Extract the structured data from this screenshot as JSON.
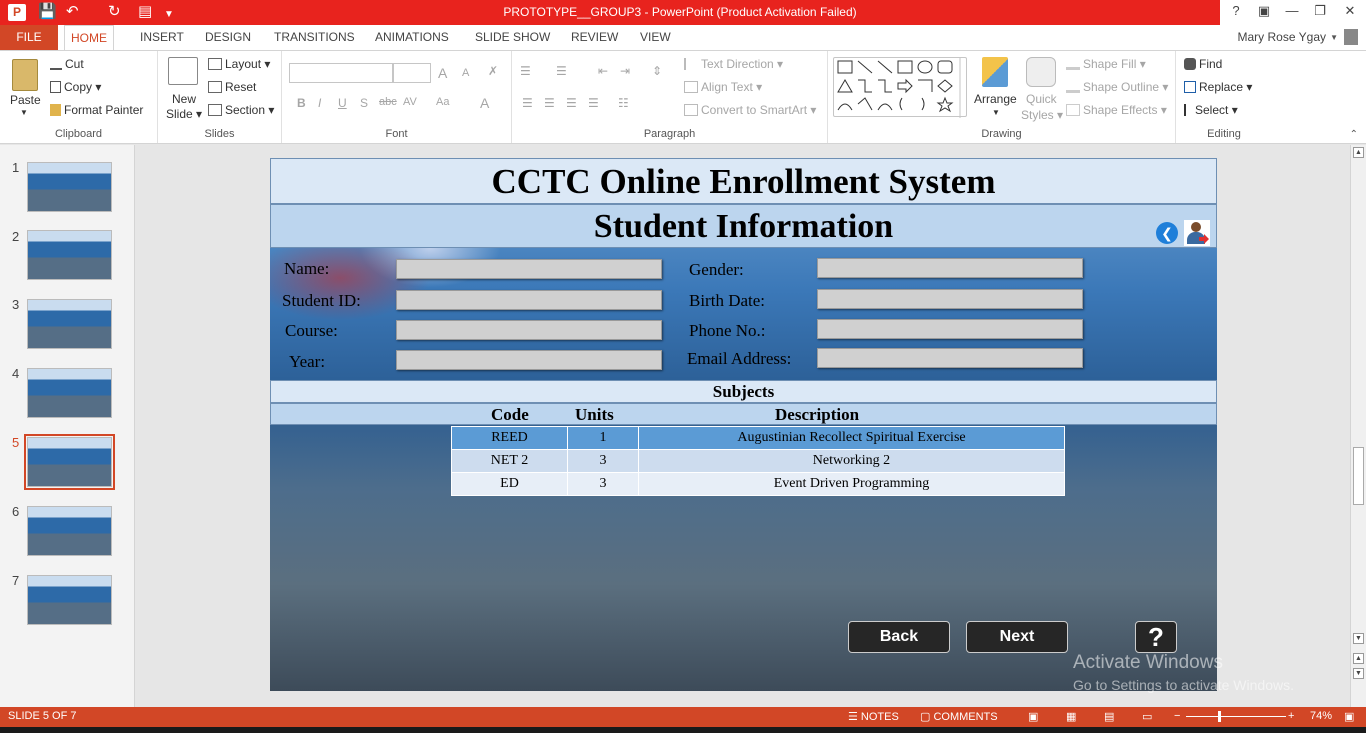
{
  "window": {
    "title": "PROTOTYPE__GROUP3 -  PowerPoint (Product Activation Failed)",
    "app_logo": "P",
    "help": "?",
    "user_name": "Mary Rose Ygay"
  },
  "tabs": [
    "FILE",
    "HOME",
    "INSERT",
    "DESIGN",
    "TRANSITIONS",
    "ANIMATIONS",
    "SLIDE SHOW",
    "REVIEW",
    "VIEW"
  ],
  "ribbon": {
    "clipboard": {
      "label": "Clipboard",
      "paste": "Paste",
      "cut": "Cut",
      "copy": "Copy",
      "format_painter": "Format Painter"
    },
    "slides": {
      "label": "Slides",
      "new_slide_1": "New",
      "new_slide_2": "Slide",
      "layout": "Layout",
      "reset": "Reset",
      "section": "Section"
    },
    "font": {
      "label": "Font",
      "bold": "B",
      "italic": "I",
      "underline": "U",
      "shadow": "S",
      "strike": "abc",
      "spacing": "AV",
      "case": "Aa",
      "grow": "A",
      "shrink": "A",
      "color": "A"
    },
    "paragraph": {
      "label": "Paragraph",
      "text_direction": "Text Direction",
      "align_text": "Align Text",
      "convert_smartart": "Convert to SmartArt"
    },
    "drawing": {
      "label": "Drawing",
      "arrange": "Arrange",
      "quick_styles_1": "Quick",
      "quick_styles_2": "Styles",
      "shape_fill": "Shape Fill",
      "shape_outline": "Shape Outline",
      "shape_effects": "Shape Effects"
    },
    "editing": {
      "label": "Editing",
      "find": "Find",
      "replace": "Replace",
      "select": "Select"
    }
  },
  "thumbnails": [
    "1",
    "2",
    "3",
    "4",
    "5",
    "6",
    "7"
  ],
  "slide": {
    "title": "CCTC Online Enrollment System",
    "subtitle": "Student Information",
    "fields": {
      "name": "Name:",
      "student_id": "Student ID:",
      "course": "Course:",
      "year": "Year:",
      "gender": "Gender:",
      "birth_date": "Birth Date:",
      "phone": "Phone No.:",
      "email": "Email Address:"
    },
    "subjects_heading": "Subjects",
    "columns": [
      "Code",
      "Units",
      "Description"
    ],
    "rows": [
      {
        "code": "REED",
        "units": "1",
        "description": "Augustinian Recollect Spiritual Exercise"
      },
      {
        "code": "NET 2",
        "units": "3",
        "description": "Networking 2"
      },
      {
        "code": "ED",
        "units": "3",
        "description": "Event Driven Programming"
      }
    ],
    "back_label": "Back",
    "next_label": "Next",
    "help_label": "?"
  },
  "watermark": {
    "line1": "Activate Windows",
    "line2": "Go to Settings to activate Windows."
  },
  "status": {
    "slide_count": "SLIDE 5 OF 7",
    "notes": "NOTES",
    "comments": "COMMENTS",
    "zoom": "74%"
  }
}
